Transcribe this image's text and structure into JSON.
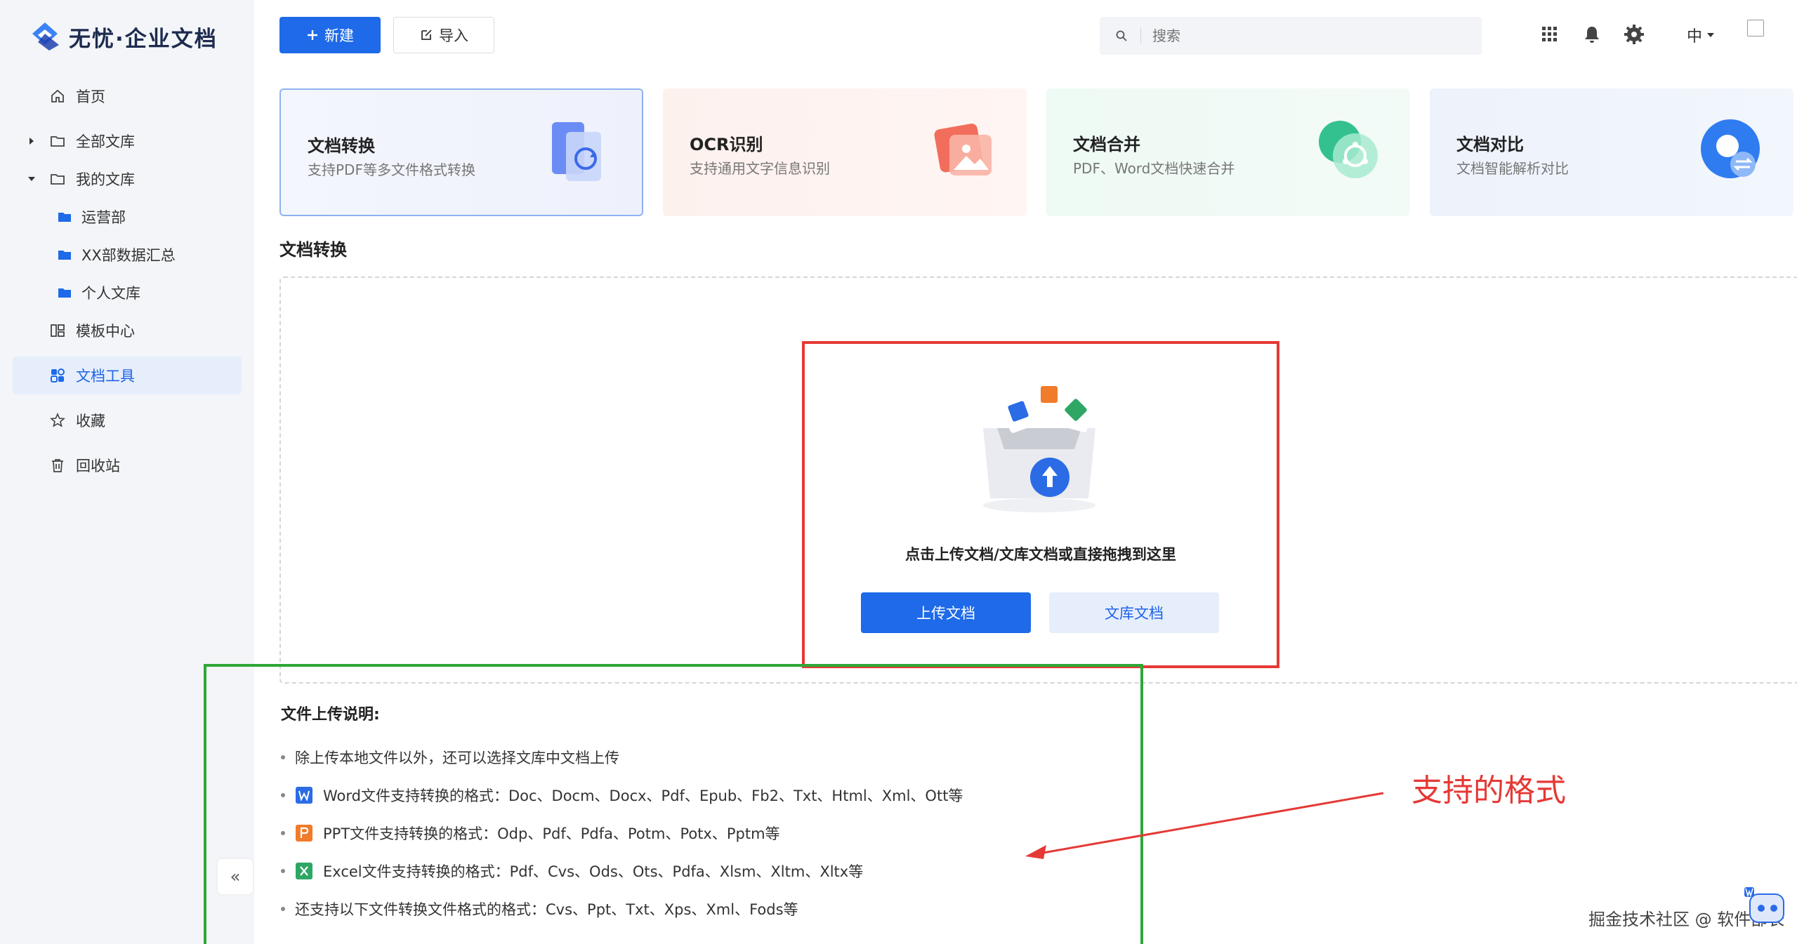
{
  "brand": {
    "name": "无忧·企业文档"
  },
  "sidebar": {
    "items": [
      {
        "label": "首页"
      },
      {
        "label": "全部文库"
      },
      {
        "label": "我的文库"
      },
      {
        "label": "运营部"
      },
      {
        "label": "XX部数据汇总"
      },
      {
        "label": "个人文库"
      },
      {
        "label": "模板中心"
      },
      {
        "label": "文档工具"
      },
      {
        "label": "收藏"
      },
      {
        "label": "回收站"
      }
    ],
    "collapse_label": "«"
  },
  "toolbar": {
    "new_label": "新建",
    "import_label": "导入"
  },
  "search": {
    "placeholder": "搜索"
  },
  "header": {
    "lang": "中"
  },
  "cards": [
    {
      "title": "文档转换",
      "desc": "支持PDF等多文件格式转换"
    },
    {
      "title": "OCR识别",
      "desc": "支持通用文字信息识别"
    },
    {
      "title": "文档合并",
      "desc": "PDF、Word文档快速合并"
    },
    {
      "title": "文档对比",
      "desc": "文档智能解析对比"
    }
  ],
  "section": {
    "title": "文档转换"
  },
  "upload": {
    "hint": "点击上传文档/文库文档或直接拖拽到这里",
    "upload_btn": "上传文档",
    "library_btn": "文库文档"
  },
  "notes": {
    "title": "文件上传说明:",
    "items": [
      "除上传本地文件以外，还可以选择文库中文档上传",
      "Word文件支持转换的格式：Doc、Docm、Docx、Pdf、Epub、Fb2、Txt、Html、Xml、Ott等",
      "PPT文件支持转换的格式：Odp、Pdf、Pdfa、Potm、Potx、Pptm等",
      "Excel文件支持转换的格式：Pdf、Cvs、Ods、Ots、Pdfa、Xlsm、Xltm、Xltx等",
      "还支持以下文件转换文件格式的格式：Cvs、Ppt、Txt、Xps、Xml、Fods等"
    ]
  },
  "annotation": {
    "text": "支持的格式"
  },
  "watermark": {
    "text": "掘金技术社区 @ 软件部长"
  },
  "colors": {
    "primary": "#1e6ae8",
    "annotation_red": "#e53935",
    "annotation_green": "#2ea737"
  }
}
